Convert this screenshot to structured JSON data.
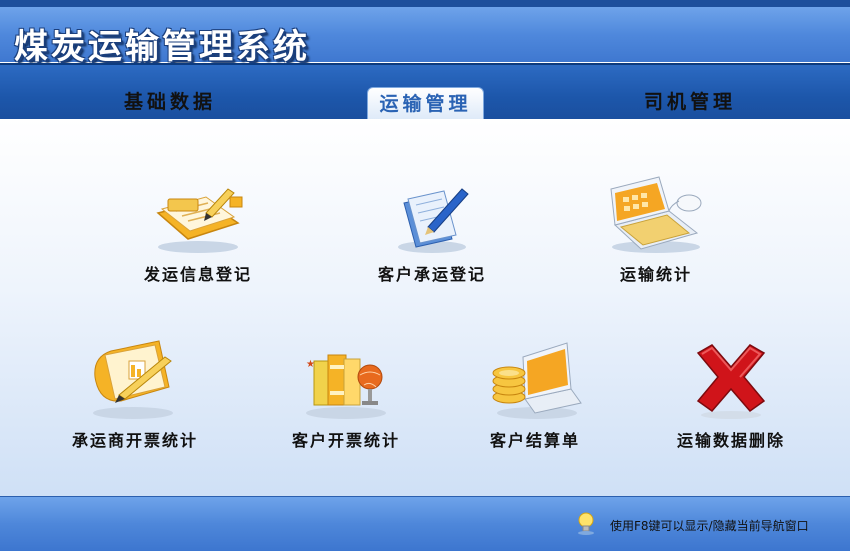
{
  "app": {
    "title": "煤炭运输管理系统"
  },
  "tabs": [
    {
      "label": "基础数据",
      "active": false
    },
    {
      "label": "运输管理",
      "active": true
    },
    {
      "label": "司机管理",
      "active": false
    }
  ],
  "items": [
    {
      "label": "发运信息登记",
      "icon": "notepad-pencil-icon"
    },
    {
      "label": "客户承运登记",
      "icon": "documents-pen-icon"
    },
    {
      "label": "运输统计",
      "icon": "laptop-mouse-icon"
    },
    {
      "label": "承运商开票统计",
      "icon": "document-chart-icon"
    },
    {
      "label": "客户开票统计",
      "icon": "books-globe-icon"
    },
    {
      "label": "客户结算单",
      "icon": "coins-laptop-icon"
    },
    {
      "label": "运输数据删除",
      "icon": "red-x-icon"
    }
  ],
  "footer": {
    "hint": "使用F8键可以显示/隐藏当前导航窗口",
    "icon": "lightbulb-icon"
  },
  "colors": {
    "header": "#4f88dc",
    "tabbar": "#1d57ab",
    "active_tab_text": "#2a63b4",
    "delete_red": "#c8141a"
  }
}
